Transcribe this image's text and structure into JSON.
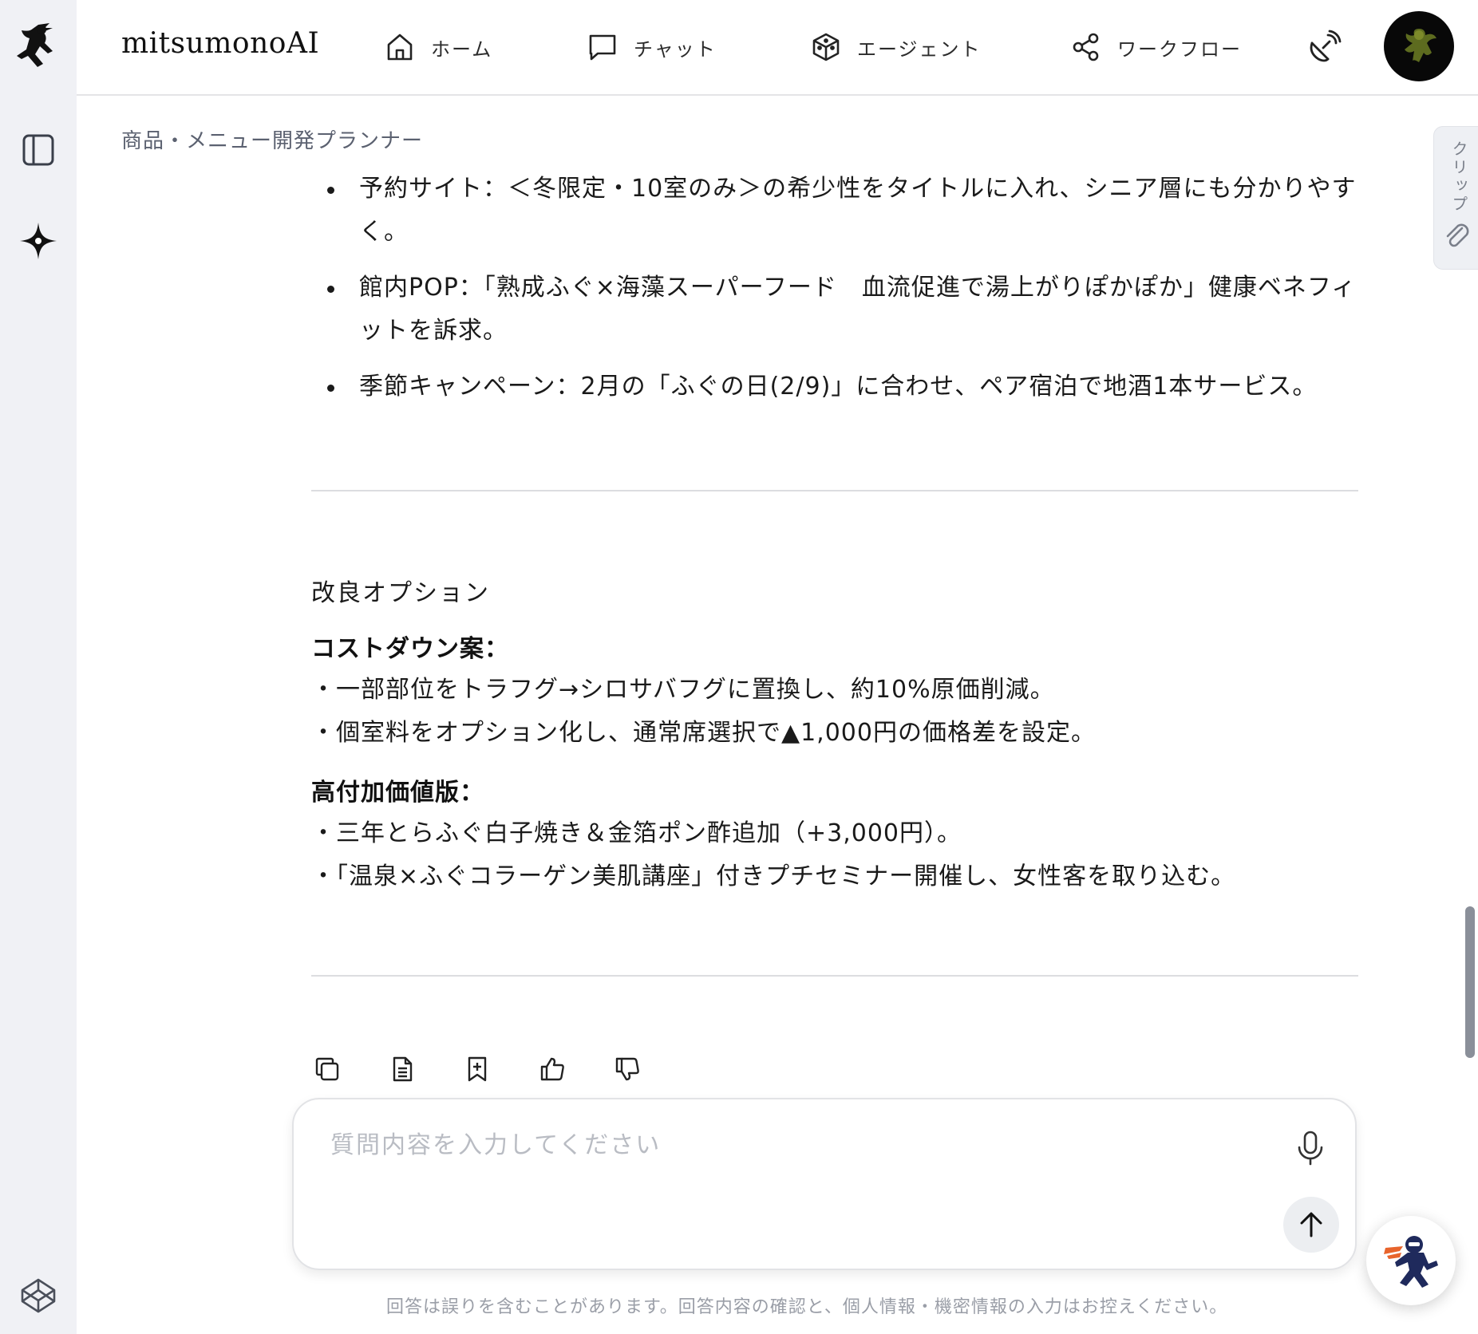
{
  "app": {
    "brand": "mitsumonoAI"
  },
  "nav": [
    {
      "label": "ホーム",
      "icon": "home-icon"
    },
    {
      "label": "チャット",
      "icon": "chat-icon"
    },
    {
      "label": "エージェント",
      "icon": "cube-icon"
    },
    {
      "label": "ワークフロー",
      "icon": "share-nodes-icon"
    }
  ],
  "breadcrumb": "商品・メニュー開発プランナー",
  "side_tab": {
    "label": "クリップ",
    "icon": "paperclip-icon"
  },
  "message": {
    "bullets": [
      "予約サイト：＜冬限定・10室のみ＞の希少性をタイトルに入れ、シニア層にも分かりやすく。",
      "館内POP：「熟成ふぐ×海藻スーパーフード　血流促進で湯上がりぽかぽか」健康ベネフィットを訴求。",
      "季節キャンペーン：2月の「ふぐの日(2/9)」に合わせ、ペア宿泊で地酒1本サービス。"
    ],
    "options_title": "改良オプション",
    "cost_down": {
      "heading": "コストダウン案：",
      "lines": [
        "・一部部位をトラフグ→シロサバフグに置換し、約10%原価削減。",
        "・個室料をオプション化し、通常席選択で▲1,000円の価格差を設定。"
      ]
    },
    "premium": {
      "heading": "高付加価値版：",
      "lines": [
        "・三年とらふぐ白子焼き＆金箔ポン酢追加（+3,000円）。",
        "・「温泉×ふぐコラーゲン美肌講座」付きプチセミナー開催し、女性客を取り込む。"
      ]
    }
  },
  "actions": [
    "copy-icon",
    "document-icon",
    "bookmark-add-icon",
    "thumbs-up-icon",
    "thumbs-down-icon"
  ],
  "composer": {
    "placeholder": "質問内容を入力してください",
    "value": ""
  },
  "disclaimer": "回答は誤りを含むことがあります。回答内容の確認と、個人情報・機密情報の入力はお控えください。",
  "colors": {
    "rail_bg": "#f0f1f5",
    "text": "#1a1a1a",
    "muted": "#9a9ea7",
    "accent_orange": "#e8642c",
    "ninja_navy": "#1f2a5c"
  }
}
